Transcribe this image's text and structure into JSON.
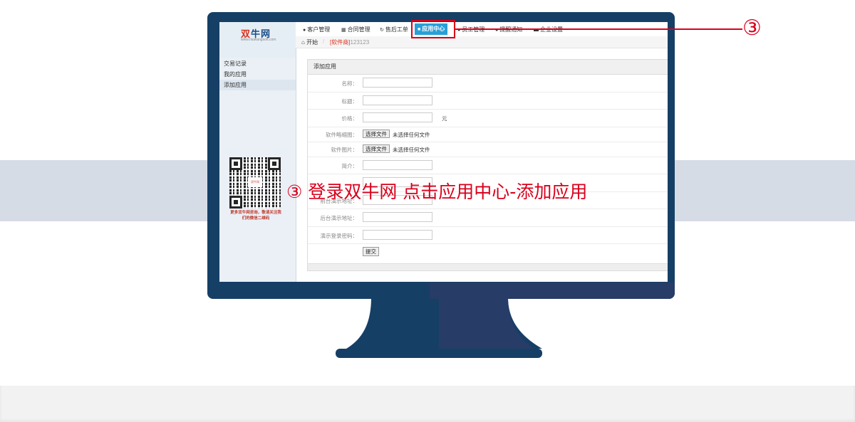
{
  "logo": {
    "mark": "双",
    "name": "牛网",
    "sub": "www.niuwangsoft.com"
  },
  "sidebar": {
    "items": [
      {
        "label": "交易记录"
      },
      {
        "label": "我的应用"
      },
      {
        "label": "添加应用"
      }
    ]
  },
  "qr": {
    "caption": "更多双牛网咨询，敬请关注我们的微信二维码",
    "center": "双牛网"
  },
  "topnav": {
    "items": [
      {
        "label": "客户管理",
        "icon": "user-icon"
      },
      {
        "label": "合同管理",
        "icon": "document-icon"
      },
      {
        "label": "售后工单",
        "icon": "refresh-icon"
      },
      {
        "label": "应用中心",
        "icon": "file-icon"
      },
      {
        "label": "员工管理",
        "icon": "globe-icon"
      },
      {
        "label": "提醒通知",
        "icon": "user-icon"
      },
      {
        "label": "企业设置",
        "icon": "card-icon"
      }
    ]
  },
  "breadcrumb": {
    "home": "开始",
    "separator": "/",
    "tag": "[软件商]",
    "current": "123123"
  },
  "form": {
    "title": "添加应用",
    "fields": [
      {
        "label": "名称：",
        "type": "text",
        "value": ""
      },
      {
        "label": "标题：",
        "type": "text",
        "value": ""
      },
      {
        "label": "价格：",
        "type": "text",
        "value": "",
        "unit": "元"
      },
      {
        "label": "软件略缩图：",
        "type": "file",
        "button": "选择文件",
        "status": "未选择任何文件"
      },
      {
        "label": "软件图片：",
        "type": "file",
        "button": "选择文件",
        "status": "未选择任何文件"
      },
      {
        "label": "简介：",
        "type": "text",
        "value": ""
      },
      {
        "label": "",
        "type": "text",
        "value": ""
      },
      {
        "label": "前台演示地址：",
        "type": "text",
        "value": ""
      },
      {
        "label": "后台演示地址：",
        "type": "text",
        "value": ""
      },
      {
        "label": "演示登录密码：",
        "type": "text",
        "value": ""
      }
    ],
    "submit": "提交"
  },
  "annotation": {
    "number": "③",
    "caption": "③ 登录双牛网 点击应用中心-添加应用",
    "color": "#d9001b"
  },
  "colors": {
    "accent": "#2a9fd6",
    "monitor": "#163f66",
    "highlight": "#d9001b"
  }
}
